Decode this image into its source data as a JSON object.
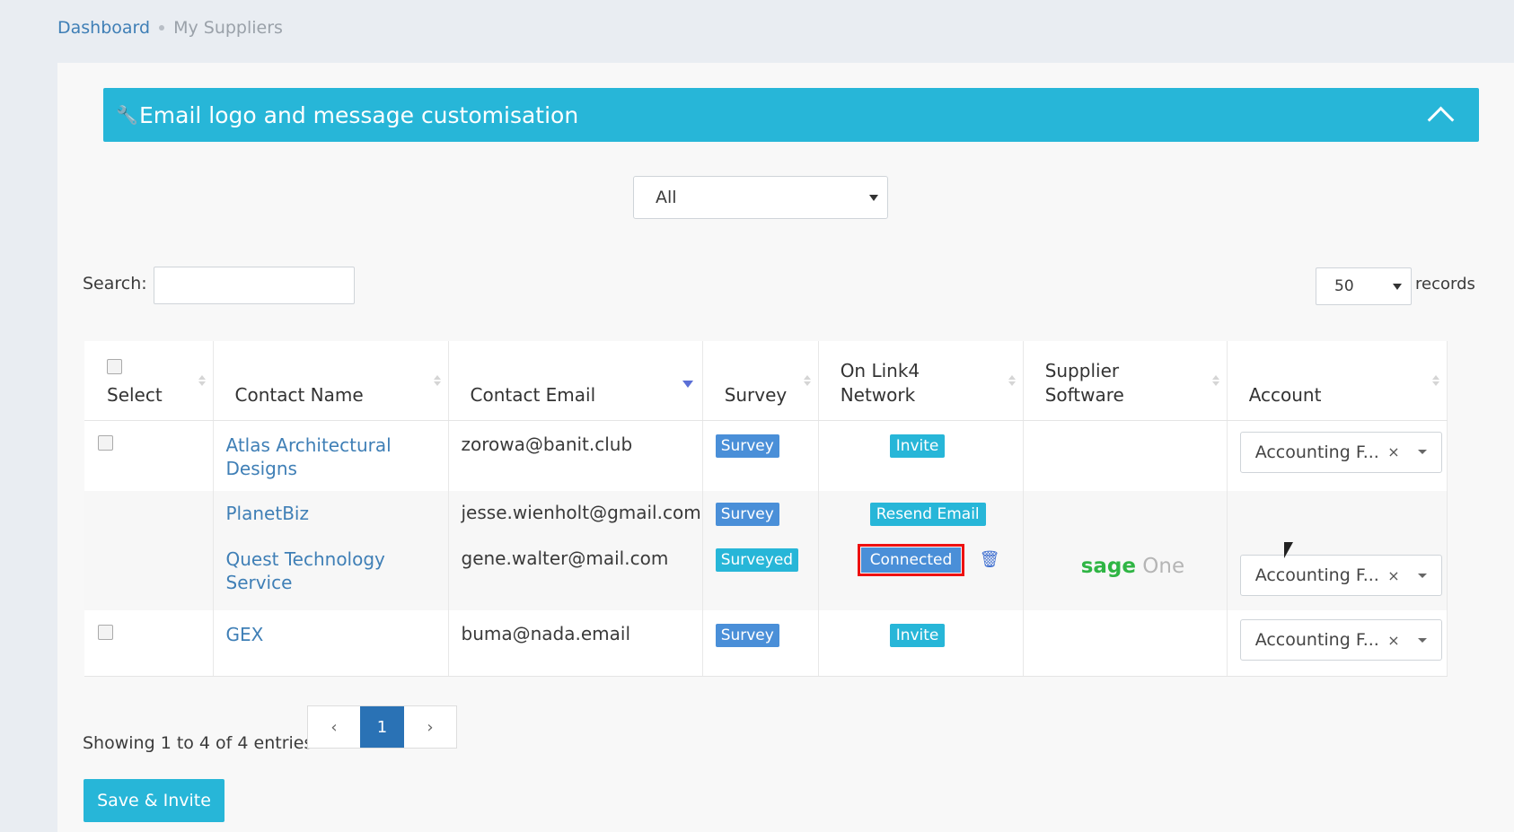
{
  "breadcrumb": {
    "home": "Dashboard",
    "current": "My Suppliers"
  },
  "banner": {
    "title": "Email logo and message customisation"
  },
  "filter": {
    "selected": "All"
  },
  "search": {
    "label": "Search:",
    "value": ""
  },
  "records": {
    "selected": "50",
    "label": "records"
  },
  "table": {
    "headers": {
      "select": "Select",
      "contact_name": "Contact Name",
      "contact_email": "Contact Email",
      "survey": "Survey",
      "network_line1": "On Link4",
      "network_line2": "Network",
      "software_line1": "Supplier",
      "software_line2": "Software",
      "account": "Account"
    },
    "rows": [
      {
        "name_line1": "Atlas Architectural",
        "name_line2": "Designs",
        "email": "zorowa@banit.club",
        "survey": "Survey",
        "network": "Invite",
        "account": "Accounting F..."
      },
      {
        "name": "PlanetBiz",
        "email": "jesse.wienholt@gmail.com",
        "survey": "Survey",
        "network": "Resend Email"
      },
      {
        "name": "Quest Technology Service",
        "email": "gene.walter@mail.com",
        "survey": "Surveyed",
        "network": "Connected",
        "software_part1": "sage",
        "software_part2": "One",
        "account": "Accounting F..."
      },
      {
        "name": "GEX",
        "email": "buma@nada.email",
        "survey": "Survey",
        "network": "Invite",
        "account": "Accounting F..."
      }
    ],
    "account_clear": "×"
  },
  "footer": {
    "showing": "Showing 1 to 4 of 4 entries",
    "pager": {
      "prev": "‹",
      "page": "1",
      "next": "›"
    },
    "save_button": "Save & Invite"
  },
  "colors": {
    "accent": "#27b6d8",
    "link": "#3f7fb6",
    "primary": "#4a8fd8",
    "highlight": "#ee1111"
  }
}
